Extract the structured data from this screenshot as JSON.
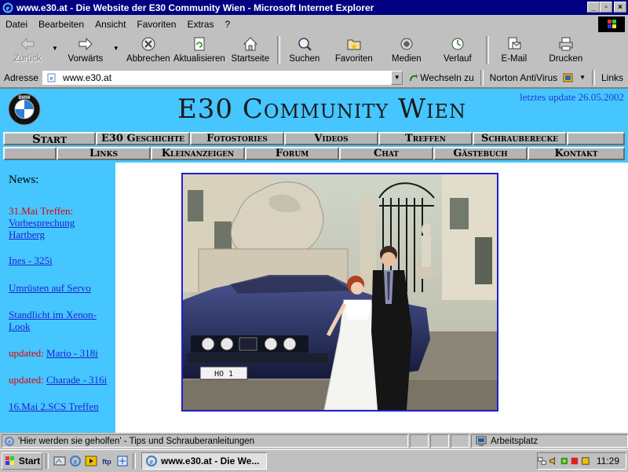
{
  "window": {
    "title": "www.e30.at - Die Website der E30 Community Wien - Microsoft Internet Explorer",
    "minimize": "_",
    "maximize": "▫",
    "close": "×"
  },
  "menu": {
    "items": [
      "Datei",
      "Bearbeiten",
      "Ansicht",
      "Favoriten",
      "Extras",
      "?"
    ]
  },
  "toolbar": {
    "back": "Zurück",
    "forward": "Vorwärts",
    "stop": "Abbrechen",
    "refresh": "Aktualisieren",
    "home": "Startseite",
    "search": "Suchen",
    "favorites": "Favoriten",
    "media": "Medien",
    "history": "Verlauf",
    "mail": "E-Mail",
    "print": "Drucken"
  },
  "address": {
    "label": "Adresse",
    "url": "www.e30.at",
    "go": "Wechseln zu",
    "antivirus": "Norton AntiVirus",
    "links": "Links"
  },
  "site": {
    "title": "E30 Community Wien",
    "last_update": "letztes update 26.05.2002",
    "bmw_logo_text": "BMW",
    "nav_row1": [
      "Start",
      "E30 Geschichte",
      "Fotostories",
      "Videos",
      "Treffen",
      "Schrauberecke"
    ],
    "nav_row2": [
      "Links",
      "Kleinanzeigen",
      "Forum",
      "Chat",
      "Gästebuch",
      "Kontakt"
    ],
    "news_title": "News:",
    "news": {
      "n1_red": "31.Mai Treffen:",
      "n1_link": "Vorbesprechung Hartberg",
      "n2": "Ines - 325i",
      "n3": "Umrüsten auf Servo",
      "n4": "Standlicht im Xenon-Look",
      "n5_prefix": "updated:",
      "n5_link": "Mario - 318i",
      "n6_prefix": "updated:",
      "n6_link": "Charade - 316i",
      "n7": "16.Mai 2.SCS Treffen"
    },
    "photo_plate": "HO 1"
  },
  "status": {
    "text": "'Hier werden sie geholfen' - Tips und Schrauberanleitungen",
    "zone": "Arbeitsplatz"
  },
  "taskbar": {
    "start": "Start",
    "task": "www.e30.at - Die We...",
    "clock": "11:29"
  },
  "colors": {
    "site_cyan": "#45c6ff",
    "nav_gray": "#b4b4b4",
    "link_blue": "#1f1fd0",
    "news_red": "#e00000",
    "titlebar": "#000080"
  }
}
